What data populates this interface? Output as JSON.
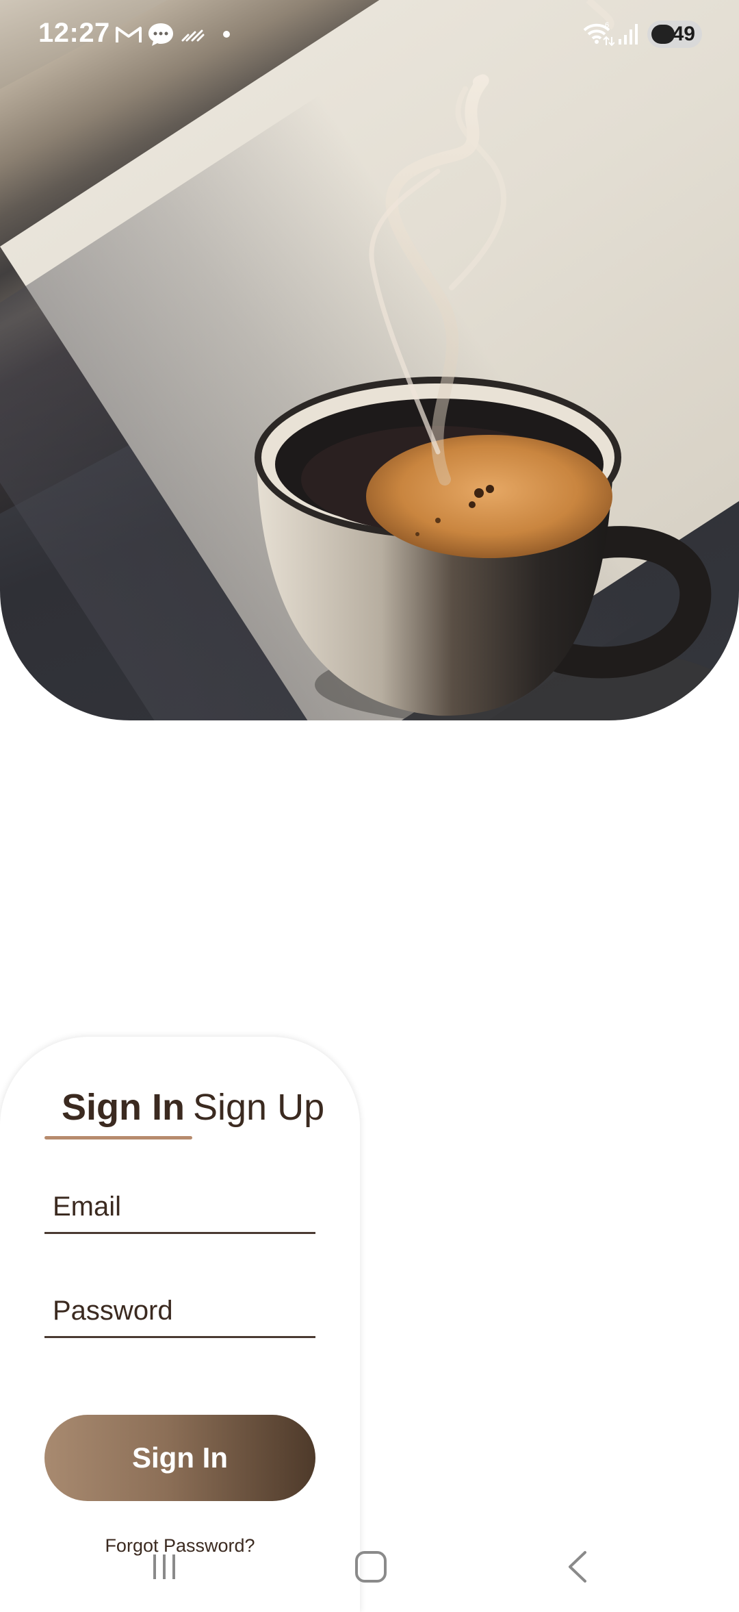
{
  "status_bar": {
    "time": "12:27",
    "battery_level": "49",
    "icons": [
      "gmail-icon",
      "chat-bubble-icon",
      "weather-icon",
      "dot-icon",
      "wifi-6-icon",
      "signal-icon",
      "battery-icon"
    ]
  },
  "auth": {
    "tabs": [
      {
        "label": "Sign In",
        "active": true
      },
      {
        "label": "Sign Up",
        "active": false
      }
    ],
    "email_placeholder": "Email",
    "password_placeholder": "Password",
    "submit_label": "Sign In",
    "forgot_label": "Forgot Password?"
  },
  "nav": {
    "icons": [
      "recent-apps-icon",
      "home-icon",
      "back-icon"
    ]
  },
  "colors": {
    "accent": "#b78b6d",
    "text": "#3b2a20",
    "button_start": "#a88a70",
    "button_end": "#4e3a2a"
  }
}
